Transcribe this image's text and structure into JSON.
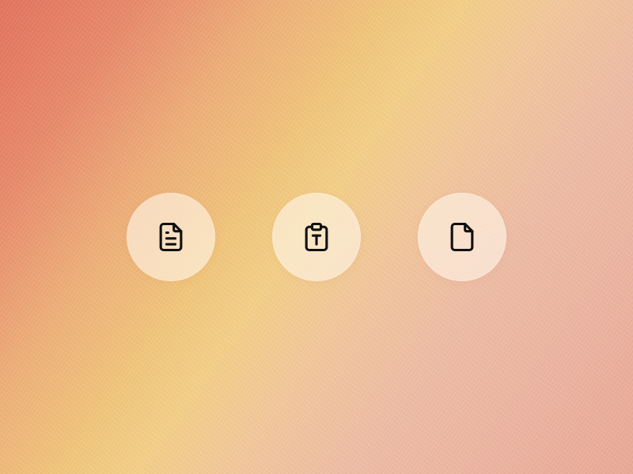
{
  "icons": [
    {
      "name": "document-text-icon",
      "color": "#111111"
    },
    {
      "name": "clipboard-text-icon",
      "color": "#111111"
    },
    {
      "name": "document-blank-icon",
      "color": "#111111"
    }
  ],
  "colors": {
    "background_start": "#e4735d",
    "background_mid": "#f3cf86",
    "background_end": "#eaa896",
    "button_fill": "#fff6e8",
    "icon_stroke": "#111111"
  }
}
